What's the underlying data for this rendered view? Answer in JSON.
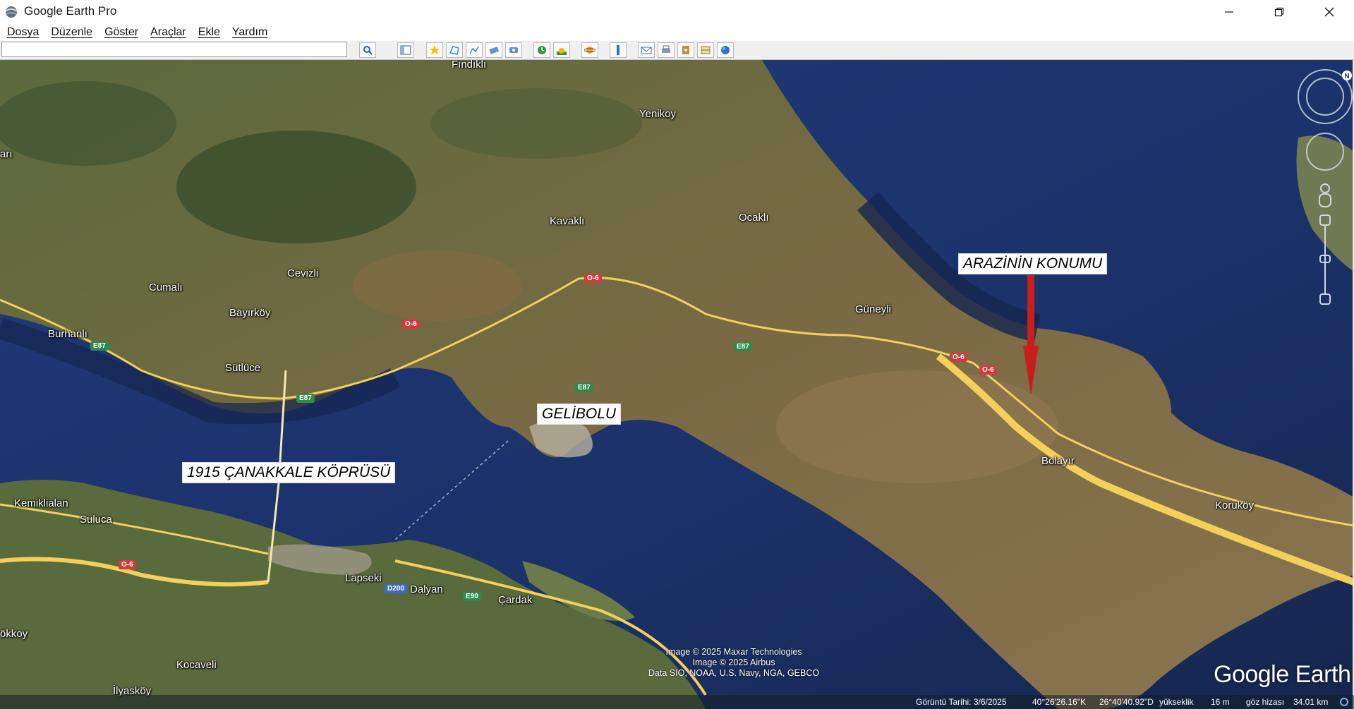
{
  "window": {
    "title": "Google Earth Pro"
  },
  "menu": [
    "Dosya",
    "Düzenle",
    "Göster",
    "Araçlar",
    "Ekle",
    "Yardım"
  ],
  "search": {
    "value": ""
  },
  "map": {
    "places": [
      {
        "name": "Fındıklı"
      },
      {
        "name": "Yenikoy"
      },
      {
        "name": "Kavaklı"
      },
      {
        "name": "Ocaklı"
      },
      {
        "name": "arı"
      },
      {
        "name": "Cevizli"
      },
      {
        "name": "Cumalı"
      },
      {
        "name": "Bayırköy"
      },
      {
        "name": "Burhanlı"
      },
      {
        "name": "Sütlüce"
      },
      {
        "name": "Güneyli"
      },
      {
        "name": "Bolayır"
      },
      {
        "name": "Koruköy"
      },
      {
        "name": "Kemiklialan"
      },
      {
        "name": "Suluca"
      },
      {
        "name": "Lapseki"
      },
      {
        "name": "Dalyan"
      },
      {
        "name": "Çardak"
      },
      {
        "name": "ökkoy"
      },
      {
        "name": "Kocaveli"
      },
      {
        "name": "İlyasköy"
      }
    ],
    "road_shields": [
      {
        "text": "O-6"
      },
      {
        "text": "O-6"
      },
      {
        "text": "O-6"
      },
      {
        "text": "O-6"
      },
      {
        "text": "O-6"
      },
      {
        "text": "E87"
      },
      {
        "text": "E87"
      },
      {
        "text": "E87"
      },
      {
        "text": "E87"
      },
      {
        "text": "D200"
      },
      {
        "text": "E90"
      }
    ],
    "callouts": {
      "bridge": "1915 ÇANAKKALE KÖPRÜSÜ",
      "town": "GELİBOLU",
      "land": "ARAZİNİN KONUMU"
    },
    "credits": [
      "Image © 2025 Maxar Technologies",
      "Image © 2025 Airbus",
      "Data SIO, NOAA, U.S. Navy, NGA, GEBCO"
    ],
    "logo": "Google Earth"
  },
  "status": {
    "date": "Görüntü Tarihi: 3/6/2025",
    "lat": "40°26'26.16\"K",
    "lon": "26°40'40.92\"D",
    "elev_label": "yükseklik",
    "elev": "16 m",
    "eye_label": "göz hizası",
    "eye": "34.01 km"
  },
  "colors": {
    "sea": "#16264e",
    "sea_light": "#1c3a72",
    "land": "#7d6a45",
    "road": "#f2d05a",
    "pointer": "#c81e1e"
  }
}
